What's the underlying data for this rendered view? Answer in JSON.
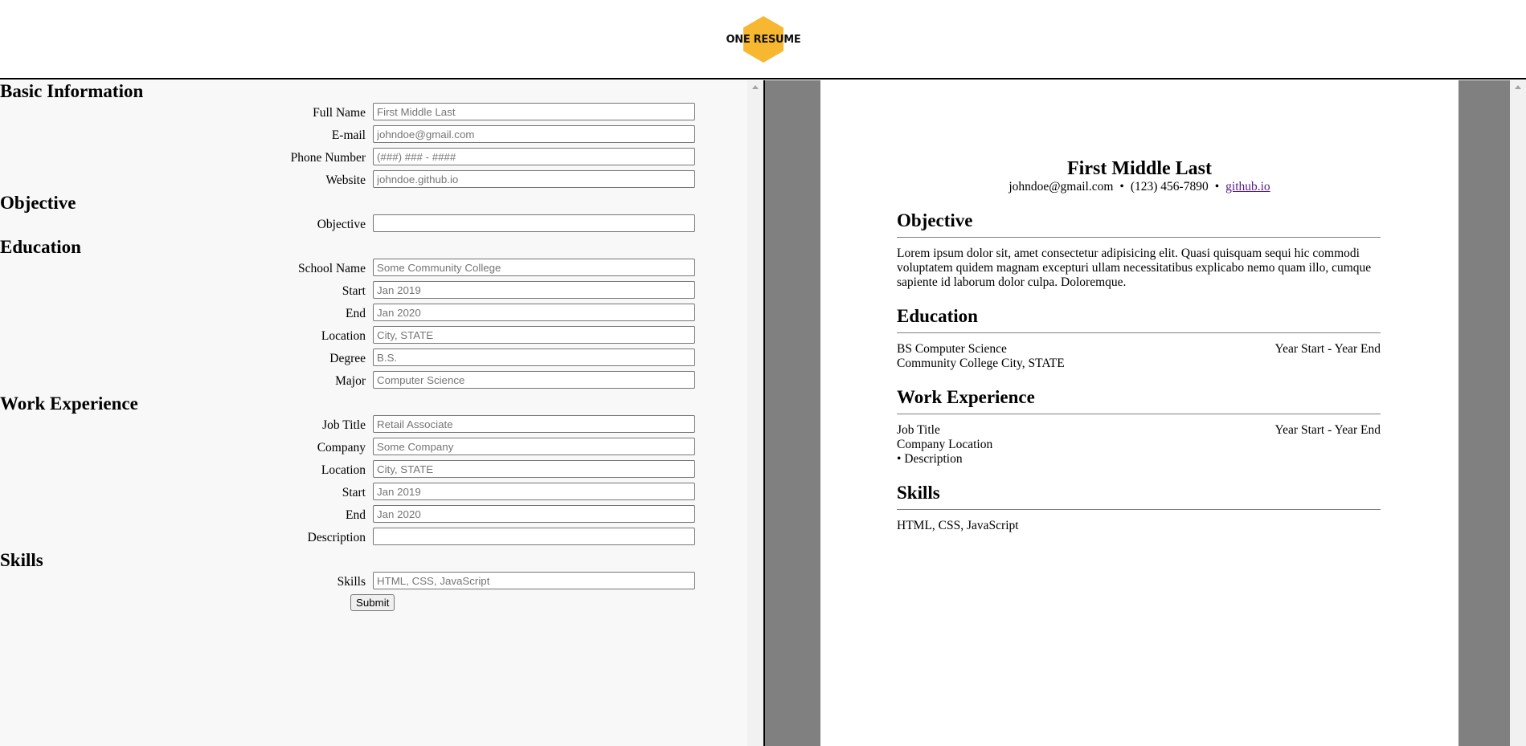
{
  "brand": {
    "logo_text": "ONE RESUME",
    "logo_color": "#F7B731"
  },
  "form": {
    "sections": {
      "basic": "Basic Information",
      "objective": "Objective",
      "education": "Education",
      "work": "Work Experience",
      "skills": "Skills"
    },
    "basic": {
      "full_name": {
        "label": "Full Name",
        "placeholder": "First Middle Last"
      },
      "email": {
        "label": "E-mail",
        "placeholder": "johndoe@gmail.com"
      },
      "phone": {
        "label": "Phone Number",
        "placeholder": "(###) ### - ####"
      },
      "website": {
        "label": "Website",
        "placeholder": "johndoe.github.io"
      }
    },
    "objective": {
      "objective": {
        "label": "Objective",
        "placeholder": ""
      }
    },
    "education": {
      "school": {
        "label": "School Name",
        "placeholder": "Some Community College"
      },
      "start": {
        "label": "Start",
        "placeholder": "Jan 2019"
      },
      "end": {
        "label": "End",
        "placeholder": "Jan 2020"
      },
      "location": {
        "label": "Location",
        "placeholder": "City, STATE"
      },
      "degree": {
        "label": "Degree",
        "placeholder": "B.S."
      },
      "major": {
        "label": "Major",
        "placeholder": "Computer Science"
      }
    },
    "work": {
      "job_title": {
        "label": "Job Title",
        "placeholder": "Retail Associate"
      },
      "company": {
        "label": "Company",
        "placeholder": "Some Company"
      },
      "location": {
        "label": "Location",
        "placeholder": "City, STATE"
      },
      "start": {
        "label": "Start",
        "placeholder": "Jan 2019"
      },
      "end": {
        "label": "End",
        "placeholder": "Jan 2020"
      },
      "description": {
        "label": "Description",
        "placeholder": ""
      }
    },
    "skills": {
      "skills": {
        "label": "Skills",
        "placeholder": "HTML, CSS, JavaScript"
      }
    },
    "submit_label": "Submit"
  },
  "resume": {
    "name": "First Middle Last",
    "email": "johndoe@gmail.com",
    "separator": "•",
    "phone": "(123) 456-7890",
    "website": "github.io",
    "objective_heading": "Objective",
    "objective_text": "Lorem ipsum dolor sit, amet consectetur adipisicing elit. Quasi quisquam sequi hic commodi voluptatem quidem magnam excepturi ullam necessitatibus explicabo nemo quam illo, cumque sapiente id laborum dolor culpa. Doloremque.",
    "education_heading": "Education",
    "education": {
      "degree_line": "BS Computer Science",
      "dates": "Year Start - Year End",
      "school_line": "Community College City, STATE"
    },
    "work_heading": "Work Experience",
    "work": {
      "title_line": "Job Title",
      "dates": "Year Start - Year End",
      "company_line": "Company Location",
      "description_line": "• Description"
    },
    "skills_heading": "Skills",
    "skills_text": "HTML, CSS, JavaScript"
  }
}
